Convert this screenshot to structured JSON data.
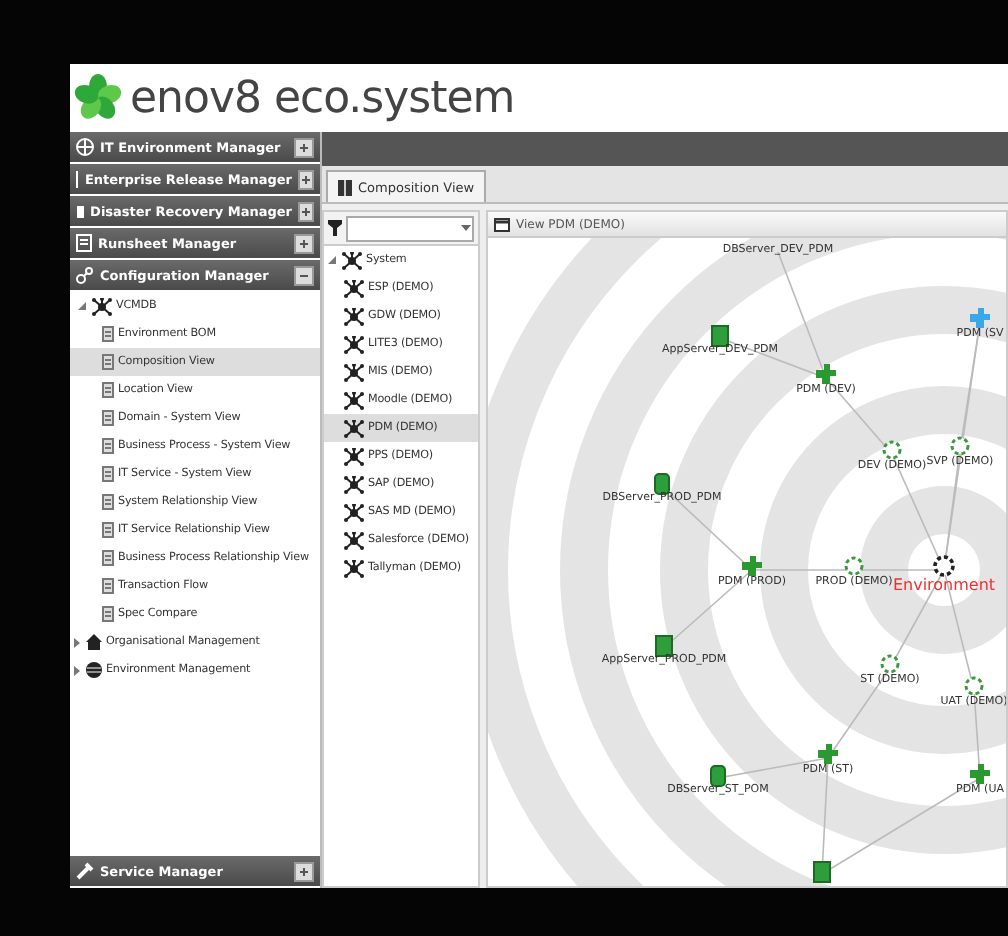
{
  "logo": {
    "brand": "enov8",
    "product": "eco.system"
  },
  "accordion": [
    {
      "title": "IT Environment Manager",
      "expanded": false
    },
    {
      "title": "Enterprise Release Manager",
      "expanded": false
    },
    {
      "title": "Disaster Recovery Manager",
      "expanded": false
    },
    {
      "title": "Runsheet Manager",
      "expanded": false
    },
    {
      "title": "Configuration Manager",
      "expanded": true
    }
  ],
  "nav_tree": {
    "label": "VCMDB",
    "expanded": true,
    "children": [
      {
        "label": "Environment BOM",
        "selected": false
      },
      {
        "label": "Composition View",
        "selected": true
      },
      {
        "label": "Location View",
        "selected": false
      },
      {
        "label": "Domain - System View",
        "selected": false
      },
      {
        "label": "Business Process - System View",
        "selected": false
      },
      {
        "label": "IT Service - System View",
        "selected": false
      },
      {
        "label": "System Relationship View",
        "selected": false
      },
      {
        "label": "IT Service Relationship View",
        "selected": false
      },
      {
        "label": "Business Process Relationship View",
        "selected": false
      },
      {
        "label": "Transaction Flow",
        "selected": false
      },
      {
        "label": "Spec Compare",
        "selected": false
      }
    ]
  },
  "nav_groups": [
    {
      "label": "Organisational Management",
      "expanded": false
    },
    {
      "label": "Environment Management",
      "expanded": false
    }
  ],
  "bottom_header": {
    "title": "Service Manager",
    "expanded": false
  },
  "tabs": [
    {
      "label": "Composition View",
      "selected": true
    }
  ],
  "system_tree": {
    "label": "System",
    "expanded": true,
    "children": [
      {
        "label": "ESP (DEMO)",
        "selected": false
      },
      {
        "label": "GDW (DEMO)",
        "selected": false
      },
      {
        "label": "LITE3 (DEMO)",
        "selected": false
      },
      {
        "label": "MIS (DEMO)",
        "selected": false
      },
      {
        "label": "Moodle (DEMO)",
        "selected": false
      },
      {
        "label": "PDM (DEMO)",
        "selected": true
      },
      {
        "label": "PPS (DEMO)",
        "selected": false
      },
      {
        "label": "SAP (DEMO)",
        "selected": false
      },
      {
        "label": "SAS MD (DEMO)",
        "selected": false
      },
      {
        "label": "Salesforce (DEMO)",
        "selected": false
      },
      {
        "label": "Tallyman (DEMO)",
        "selected": false
      }
    ]
  },
  "view": {
    "title": "View PDM (DEMO)",
    "nodes": [
      {
        "label": "DBServer_DEV_PDM",
        "kind": "label"
      },
      {
        "label": "AppServer_DEV_PDM",
        "kind": "server"
      },
      {
        "label": "PDM (DEV)",
        "kind": "application"
      },
      {
        "label": "PDM (SV",
        "kind": "application-blue"
      },
      {
        "label": "DEV (DEMO)",
        "kind": "environment"
      },
      {
        "label": "SVP (DEMO)",
        "kind": "environment"
      },
      {
        "label": "DBServer_PROD_PDM",
        "kind": "database"
      },
      {
        "label": "PDM (PROD)",
        "kind": "application"
      },
      {
        "label": "PROD (DEMO)",
        "kind": "environment"
      },
      {
        "label": "Environment",
        "kind": "root"
      },
      {
        "label": "AppServer_PROD_PDM",
        "kind": "server"
      },
      {
        "label": "ST (DEMO)",
        "kind": "environment"
      },
      {
        "label": "UAT (DEMO)",
        "kind": "environment"
      },
      {
        "label": "PDM (ST)",
        "kind": "application"
      },
      {
        "label": "DBServer_ST_POM",
        "kind": "database"
      },
      {
        "label": "PDM (UA",
        "kind": "application"
      },
      {
        "kind": "server"
      }
    ]
  }
}
